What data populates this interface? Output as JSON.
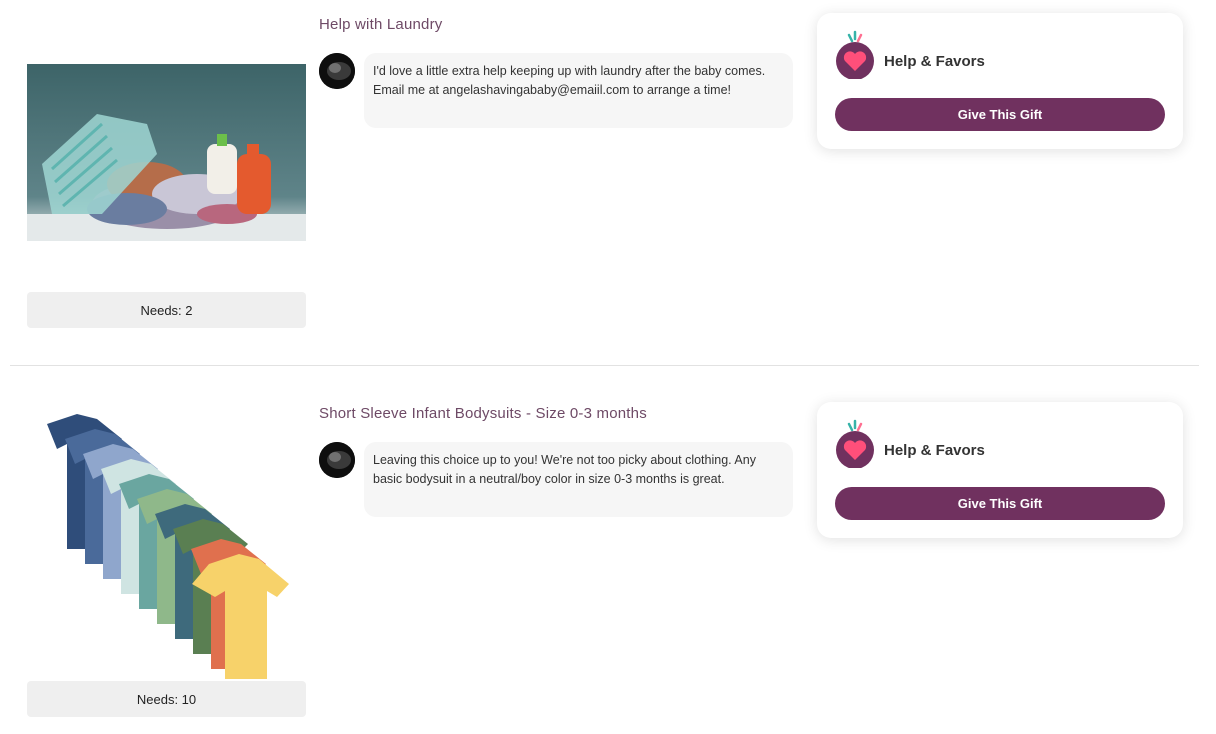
{
  "items": [
    {
      "title": "Help with Laundry",
      "message": "I'd love a little extra help keeping up with laundry after the baby comes. Email me at angelashavingababy@emaiil.com to arrange a time!",
      "needs": "Needs: 2",
      "category": "Help & Favors",
      "button": "Give This Gift",
      "image_icon": "laundry-basket-photo"
    },
    {
      "title": "Short Sleeve Infant Bodysuits - Size 0-3 months",
      "message": "Leaving this choice up to you! We're not too picky about clothing. Any basic bodysuit in a neutral/boy color in size 0-3 months is great.",
      "needs": "Needs: 10",
      "category": "Help & Favors",
      "button": "Give This Gift",
      "image_icon": "bodysuits-photo"
    }
  ],
  "colors": {
    "accent": "#70315f",
    "title": "#6e4a66",
    "heart": "#ff4f7a"
  }
}
